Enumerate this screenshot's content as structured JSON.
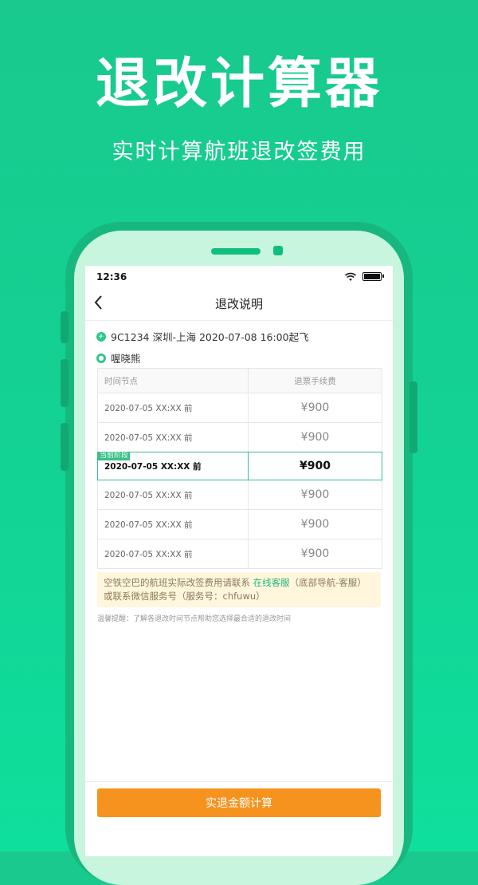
{
  "promo": {
    "title": "退改计算器",
    "subtitle": "实时计算航班退改签费用"
  },
  "status": {
    "time": "12:36"
  },
  "nav": {
    "title": "退改说明"
  },
  "flight": {
    "info": "9C1234 深圳-上海 2020-07-08 16:00起飞",
    "passenger": "喔晓熊"
  },
  "table": {
    "headers": [
      "时间节点",
      "退票手续费"
    ],
    "current_tag": "当前阶段",
    "rows": [
      {
        "time": "2020-07-05 XX:XX 前",
        "fee": "¥900"
      },
      {
        "time": "2020-07-05 XX:XX 前",
        "fee": "¥900"
      },
      {
        "time": "2020-07-05 XX:XX 前",
        "fee": "¥900"
      },
      {
        "time": "2020-07-05 XX:XX 前",
        "fee": "¥900"
      },
      {
        "time": "2020-07-05 XX:XX 前",
        "fee": "¥900"
      },
      {
        "time": "2020-07-05 XX:XX 前",
        "fee": "¥900"
      }
    ]
  },
  "notice": {
    "prefix": "空铁空巴的航班实际改签费用请联系 ",
    "link": "在线客服",
    "suffix": "（底部导航-客服）或联系微信服务号（服务号：chfuwu）"
  },
  "tip": "温馨提醒：了解各退改时间节点帮助您选择最合适的退改时间",
  "button": {
    "label": "实退金额计算"
  },
  "colors": {
    "brand_green": "#19c98d",
    "accent_green": "#3bbf86",
    "button_orange": "#f6921e",
    "notice_bg": "#fff6dd"
  }
}
